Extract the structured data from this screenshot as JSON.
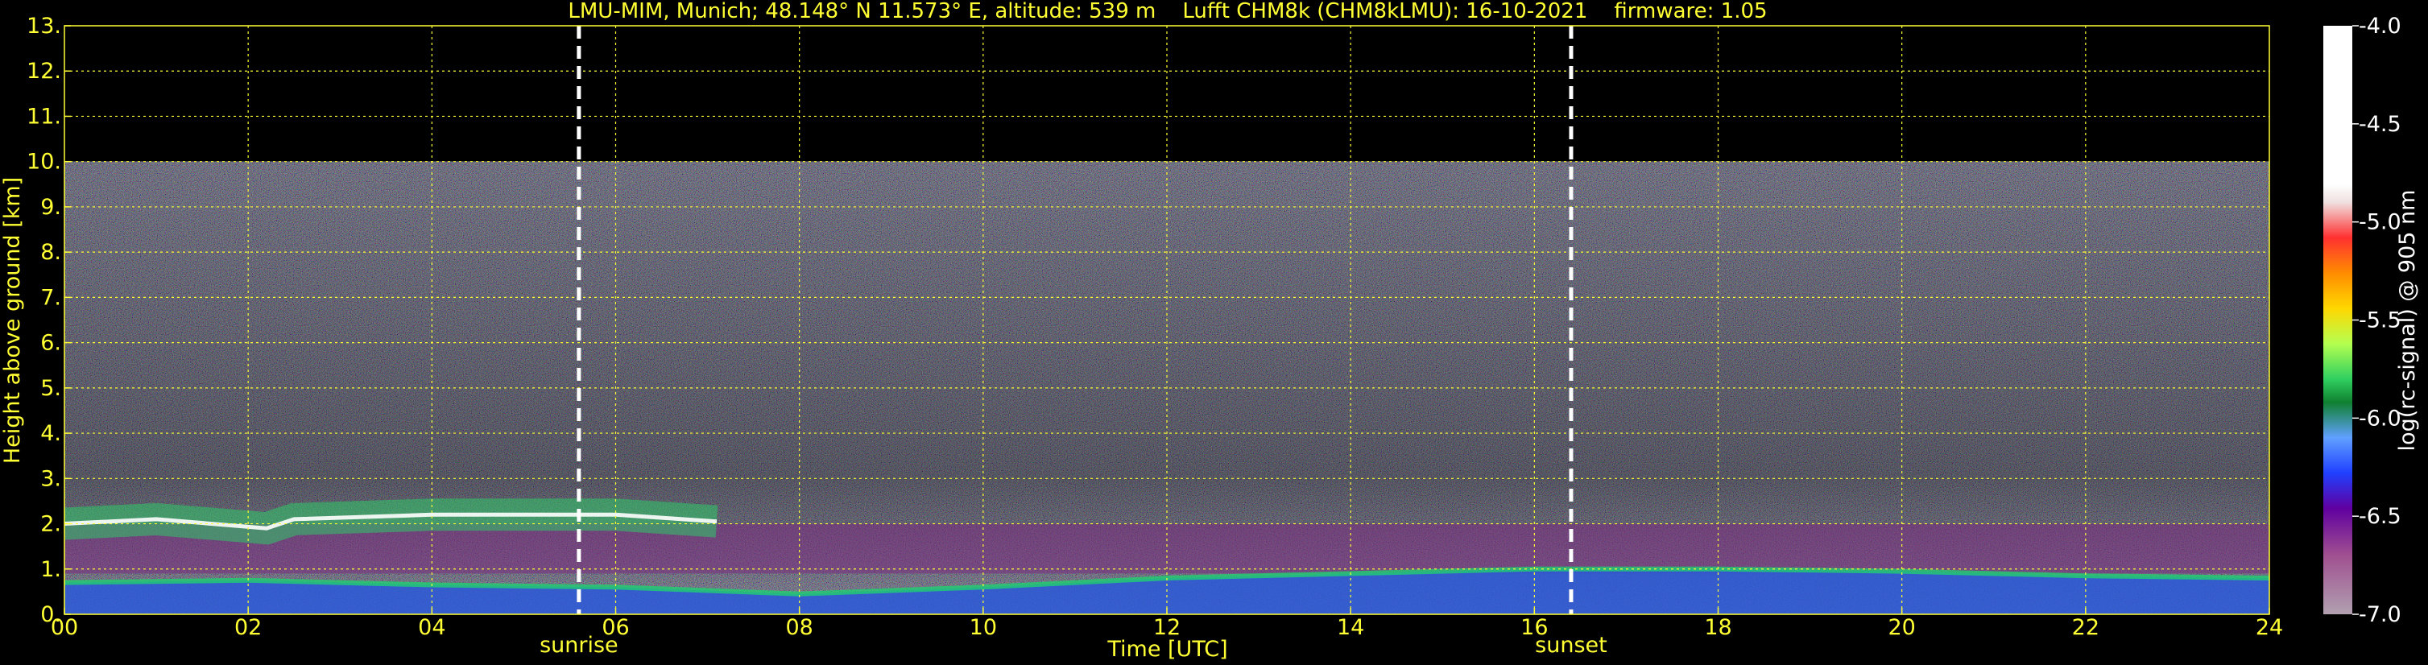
{
  "chart_data": {
    "type": "heatmap",
    "title": "LMU-MIM, Munich; 48.148° N 11.573° E, altitude: 539 m    Lufft CHM8k (CHM8kLMU): 16-10-2021    firmware: 1.05",
    "xlabel": "Time [UTC]",
    "ylabel": "Height above ground [km]",
    "xlim": [
      0,
      24
    ],
    "ylim": [
      0,
      13
    ],
    "x_ticks": [
      "00",
      "02",
      "04",
      "06",
      "08",
      "10",
      "12",
      "14",
      "16",
      "18",
      "20",
      "22",
      "24"
    ],
    "y_ticks": [
      "0.",
      "1.",
      "2.",
      "3.",
      "4.",
      "5.",
      "6.",
      "7.",
      "8.",
      "9.",
      "10.",
      "11.",
      "12.",
      "13."
    ],
    "grid": true,
    "data_top_km": 10,
    "markers": [
      {
        "label": "sunrise",
        "time": 5.6
      },
      {
        "label": "sunset",
        "time": 16.4
      }
    ],
    "colorbar": {
      "label": "log(rc-signal) @ 905 nm",
      "range": [
        -7.0,
        -4.0
      ],
      "ticks": [
        "-4.0",
        "-4.5",
        "-5.0",
        "-5.5",
        "-6.0",
        "-6.5",
        "-7.0"
      ]
    },
    "features": [
      {
        "name": "boundary-layer",
        "points": [
          [
            0,
            0.7
          ],
          [
            2,
            0.75
          ],
          [
            4,
            0.65
          ],
          [
            6,
            0.6
          ],
          [
            8,
            0.45
          ],
          [
            10,
            0.6
          ],
          [
            12,
            0.8
          ],
          [
            14,
            0.9
          ],
          [
            16,
            1.0
          ],
          [
            18,
            1.0
          ],
          [
            20,
            0.95
          ],
          [
            22,
            0.85
          ],
          [
            24,
            0.8
          ]
        ]
      },
      {
        "name": "aerosol-layer",
        "points": [
          [
            0,
            2.0
          ],
          [
            1,
            2.1
          ],
          [
            2.2,
            1.9
          ],
          [
            2.5,
            2.1
          ],
          [
            4,
            2.2
          ],
          [
            6,
            2.2
          ],
          [
            7.1,
            2.05
          ]
        ]
      }
    ]
  },
  "colors": {
    "background": "#000000",
    "axis": "#ffff33",
    "grid": "#ffff33",
    "marker": "#ffffff"
  }
}
